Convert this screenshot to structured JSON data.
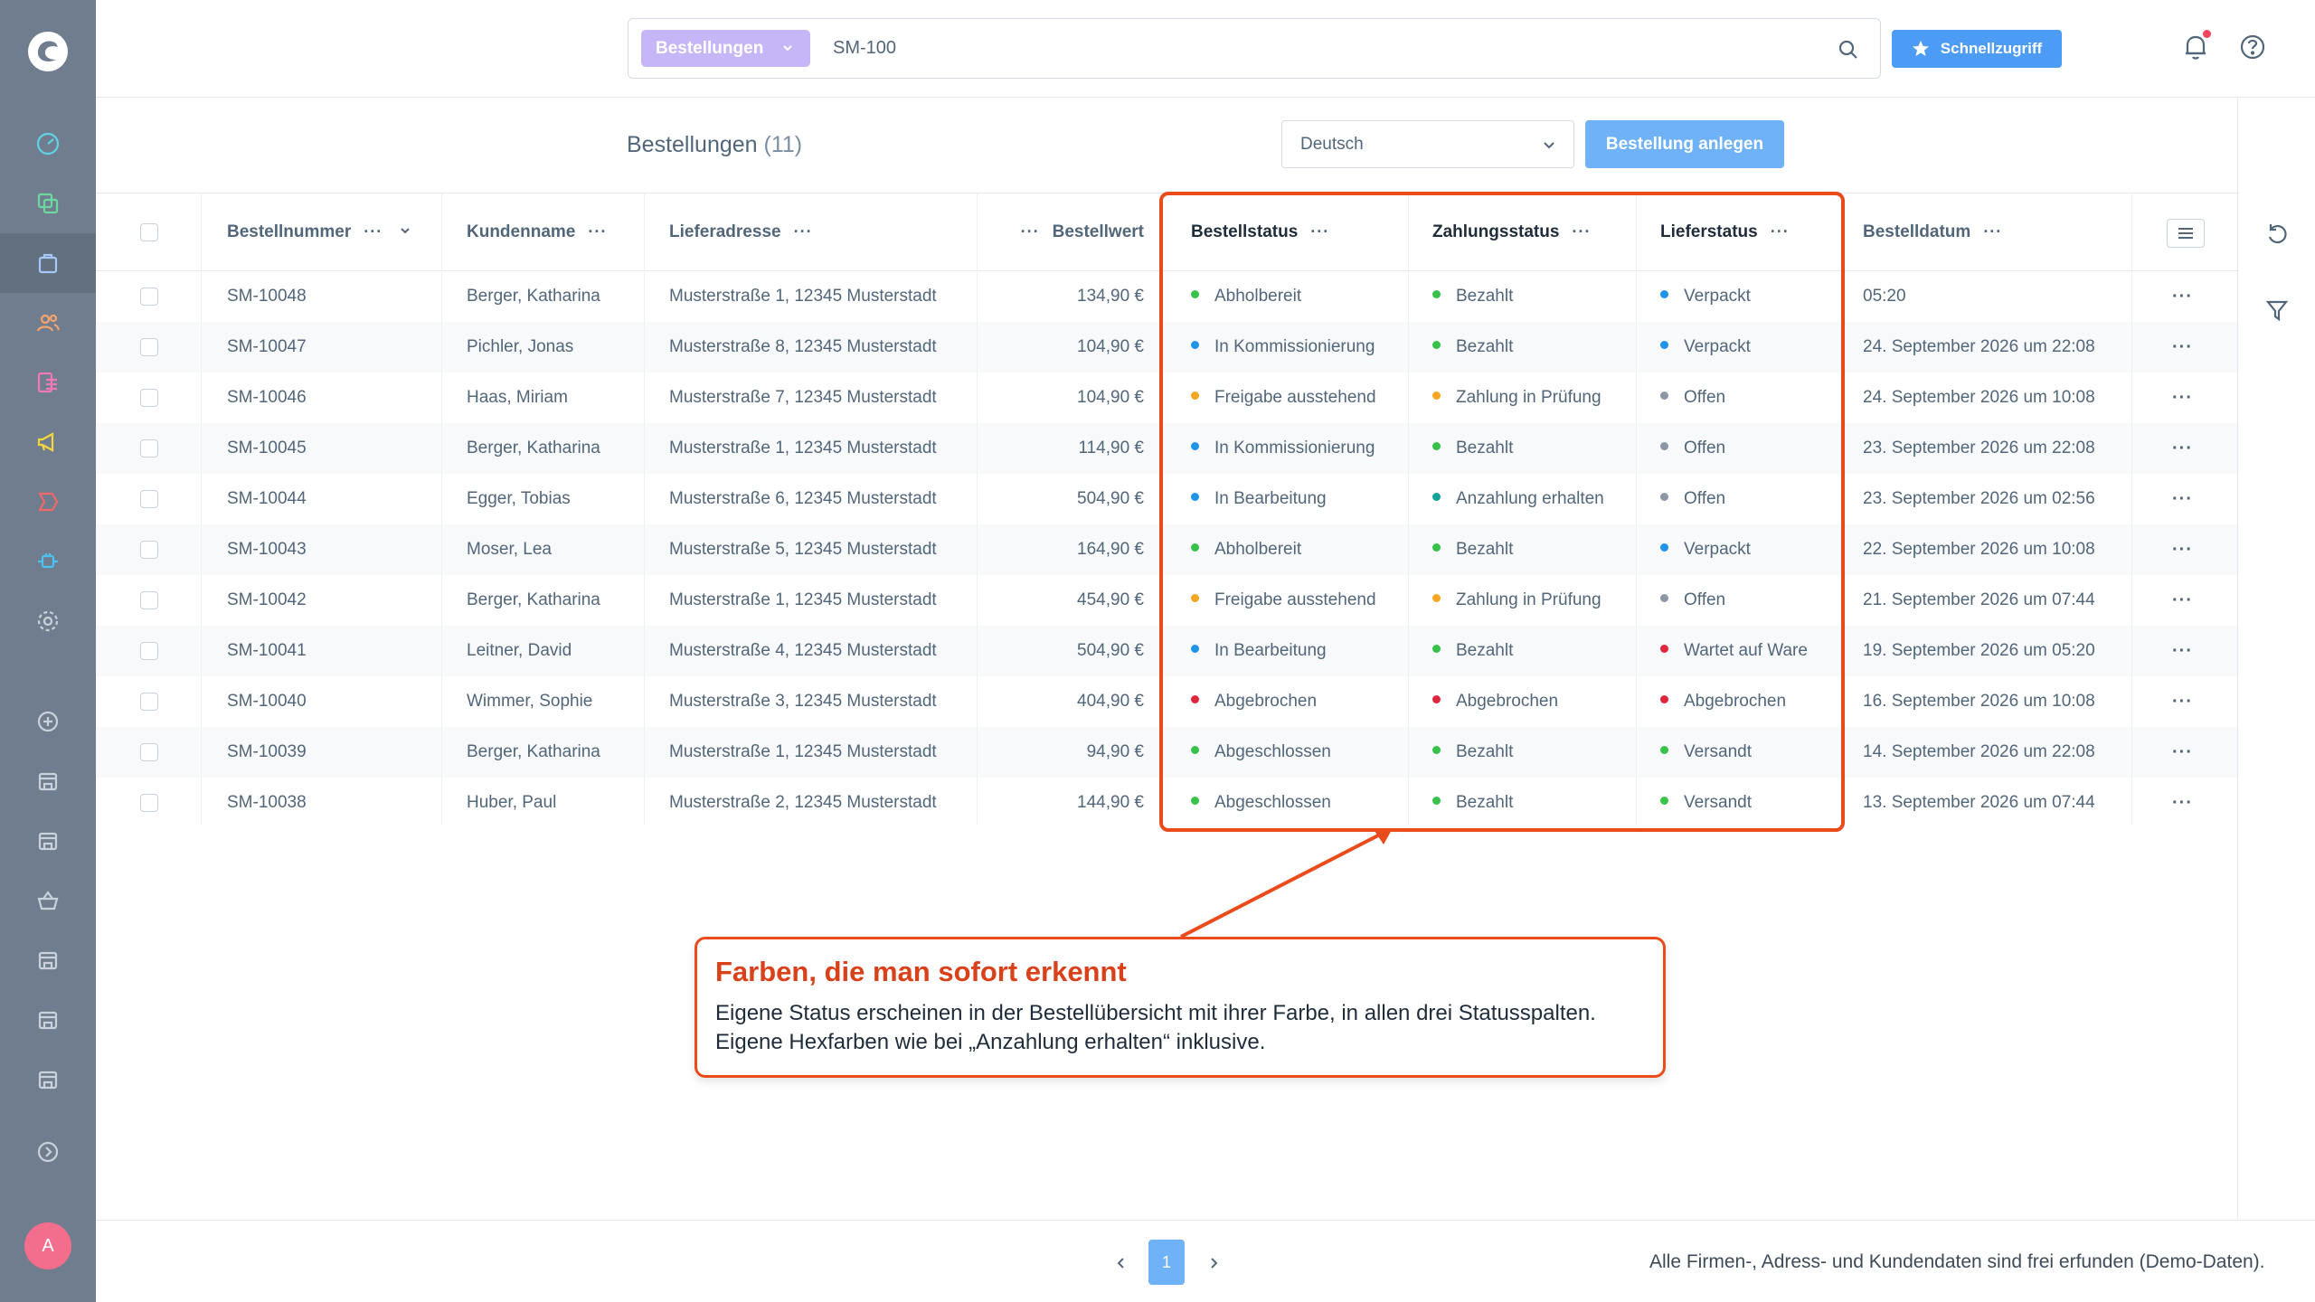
{
  "topbar": {
    "search_scope": "Bestellungen",
    "search_value": "SM-100",
    "quick_access": "Schnellzugriff"
  },
  "toolbar": {
    "title": "Bestellungen",
    "count": "(11)",
    "language": "Deutsch",
    "create_button": "Bestellung anlegen"
  },
  "table": {
    "headers": {
      "order_number": "Bestellnummer",
      "customer": "Kundenname",
      "address": "Lieferadresse",
      "value": "Bestellwert",
      "order_status": "Bestellstatus",
      "payment_status": "Zahlungsstatus",
      "delivery_status": "Lieferstatus",
      "date": "Bestelldatum"
    },
    "rows": [
      {
        "number": "SM-10048",
        "customer": "Berger, Katharina",
        "address": "Musterstraße 1, 12345 Musterstadt",
        "value": "134,90 €",
        "order_status": "Abholbereit",
        "order_color": "#37c24a",
        "payment_status": "Bezahlt",
        "payment_color": "#37c24a",
        "delivery_status": "Verpackt",
        "delivery_color": "#1f93ea",
        "date": "05:20"
      },
      {
        "number": "SM-10047",
        "customer": "Pichler, Jonas",
        "address": "Musterstraße 8, 12345 Musterstadt",
        "value": "104,90 €",
        "order_status": "In Kommissionierung",
        "order_color": "#1f93ea",
        "payment_status": "Bezahlt",
        "payment_color": "#37c24a",
        "delivery_status": "Verpackt",
        "delivery_color": "#1f93ea",
        "date": "24. September 2026 um 22:08"
      },
      {
        "number": "SM-10046",
        "customer": "Haas, Miriam",
        "address": "Musterstraße 7, 12345 Musterstadt",
        "value": "104,90 €",
        "order_status": "Freigabe ausstehend",
        "order_color": "#f5a623",
        "payment_status": "Zahlung in Prüfung",
        "payment_color": "#f5a623",
        "delivery_status": "Offen",
        "delivery_color": "#8a97a6",
        "date": "24. September 2026 um 10:08"
      },
      {
        "number": "SM-10045",
        "customer": "Berger, Katharina",
        "address": "Musterstraße 1, 12345 Musterstadt",
        "value": "114,90 €",
        "order_status": "In Kommissionierung",
        "order_color": "#1f93ea",
        "payment_status": "Bezahlt",
        "payment_color": "#37c24a",
        "delivery_status": "Offen",
        "delivery_color": "#8a97a6",
        "date": "23. September 2026 um 22:08"
      },
      {
        "number": "SM-10044",
        "customer": "Egger, Tobias",
        "address": "Musterstraße 6, 12345 Musterstadt",
        "value": "504,90 €",
        "order_status": "In Bearbeitung",
        "order_color": "#1f93ea",
        "payment_status": "Anzahlung erhalten",
        "payment_color": "#12a39a",
        "delivery_status": "Offen",
        "delivery_color": "#8a97a6",
        "date": "23. September 2026 um 02:56"
      },
      {
        "number": "SM-10043",
        "customer": "Moser, Lea",
        "address": "Musterstraße 5, 12345 Musterstadt",
        "value": "164,90 €",
        "order_status": "Abholbereit",
        "order_color": "#37c24a",
        "payment_status": "Bezahlt",
        "payment_color": "#37c24a",
        "delivery_status": "Verpackt",
        "delivery_color": "#1f93ea",
        "date": "22. September 2026 um 10:08"
      },
      {
        "number": "SM-10042",
        "customer": "Berger, Katharina",
        "address": "Musterstraße 1, 12345 Musterstadt",
        "value": "454,90 €",
        "order_status": "Freigabe ausstehend",
        "order_color": "#f5a623",
        "payment_status": "Zahlung in Prüfung",
        "payment_color": "#f5a623",
        "delivery_status": "Offen",
        "delivery_color": "#8a97a6",
        "date": "21. September 2026 um 07:44"
      },
      {
        "number": "SM-10041",
        "customer": "Leitner, David",
        "address": "Musterstraße 4, 12345 Musterstadt",
        "value": "504,90 €",
        "order_status": "In Bearbeitung",
        "order_color": "#1f93ea",
        "payment_status": "Bezahlt",
        "payment_color": "#37c24a",
        "delivery_status": "Wartet auf Ware",
        "delivery_color": "#e0263d",
        "date": "19. September 2026 um 05:20"
      },
      {
        "number": "SM-10040",
        "customer": "Wimmer, Sophie",
        "address": "Musterstraße 3, 12345 Musterstadt",
        "value": "404,90 €",
        "order_status": "Abgebrochen",
        "order_color": "#e0263d",
        "payment_status": "Abgebrochen",
        "payment_color": "#e0263d",
        "delivery_status": "Abgebrochen",
        "delivery_color": "#e0263d",
        "date": "16. September 2026 um 10:08"
      },
      {
        "number": "SM-10039",
        "customer": "Berger, Katharina",
        "address": "Musterstraße 1, 12345 Musterstadt",
        "value": "94,90 €",
        "order_status": "Abgeschlossen",
        "order_color": "#37c24a",
        "payment_status": "Bezahlt",
        "payment_color": "#37c24a",
        "delivery_status": "Versandt",
        "delivery_color": "#37c24a",
        "date": "14. September 2026 um 22:08"
      },
      {
        "number": "SM-10038",
        "customer": "Huber, Paul",
        "address": "Musterstraße 2, 12345 Musterstadt",
        "value": "144,90 €",
        "order_status": "Abgeschlossen",
        "order_color": "#37c24a",
        "payment_status": "Bezahlt",
        "payment_color": "#37c24a",
        "delivery_status": "Versandt",
        "delivery_color": "#37c24a",
        "date": "13. September 2026 um 07:44"
      }
    ]
  },
  "callout": {
    "title": "Farben, die man sofort erkennt",
    "line1": "Eigene Status erscheinen in der Bestellübersicht mit ihrer Farbe, in allen drei Statusspalten.",
    "line2": "Eigene Hexfarben wie bei „Anzahlung erhalten“ inklusive."
  },
  "pagination": {
    "current_page": "1"
  },
  "footer_note": "Alle Firmen-, Adress- und Kundendaten sind frei erfunden (Demo-Daten).",
  "avatar_initial": "A",
  "colors": {
    "sidebar": "#6f7d8f",
    "accent_button": "#4c9cf5",
    "highlight": "#ea4b1a",
    "scope_pill": "#c7b6f7"
  }
}
